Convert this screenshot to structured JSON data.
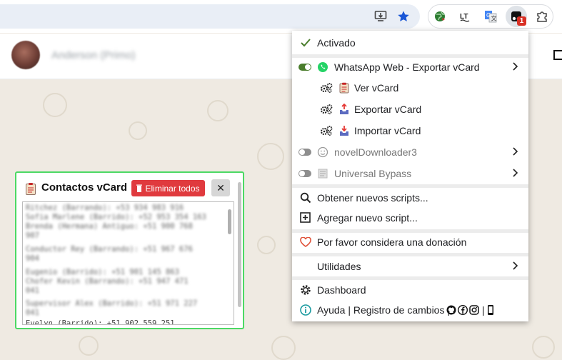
{
  "toolbar": {
    "icons": [
      "install-app-icon",
      "bookmark-star-icon",
      "extension-globe-icon",
      "languagetool-icon",
      "translate-icon",
      "tampermonkey-icon",
      "extensions-puzzle-icon"
    ],
    "userscript_badge": "1"
  },
  "chat": {
    "contact_name": "Anderson (Primo)"
  },
  "vcard_panel": {
    "title": "Contactos vCard",
    "clear_label": "Eliminar todos",
    "close_label": "✕",
    "lines": [
      "Ritchez (Barrando): +53 934 983 916",
      "Sofia Marlene (Barrido): +52 953 354 163",
      "Brenda (Hermana) Antiguo: +51 900 768",
      "907",
      "Conductor Rey (Barrando): +51 967 676",
      "904",
      "Eugenio (Barrido): +51 901 145 863",
      "Chofer Kevin (Barrando): +51 947 471",
      "041",
      "Supervisor Alex (Barrido): +51 971 227",
      "041",
      "Evelyn (Barrido): +51 902 559 251"
    ]
  },
  "menu": {
    "enabled_label": "Activado",
    "scripts": [
      {
        "name": "WhatsApp Web - Exportar vCard",
        "enabled": true
      },
      {
        "name": "novelDownloader3",
        "enabled": false
      },
      {
        "name": "Universal Bypass",
        "enabled": false
      }
    ],
    "commands": [
      "Ver vCard",
      "Exportar vCard",
      "Importar vCard"
    ],
    "get_scripts": "Obtener nuevos scripts...",
    "add_script": "Agregar nuevo script...",
    "donation": "Por favor considera una donación",
    "utilities": "Utilidades",
    "dashboard": "Dashboard",
    "help": "Ayuda | Registro de cambios |",
    "help_separator": "|",
    "colors": {
      "accent_green": "#4a7d2c",
      "panel_border": "#4cd964",
      "danger": "#e03a3e"
    }
  }
}
